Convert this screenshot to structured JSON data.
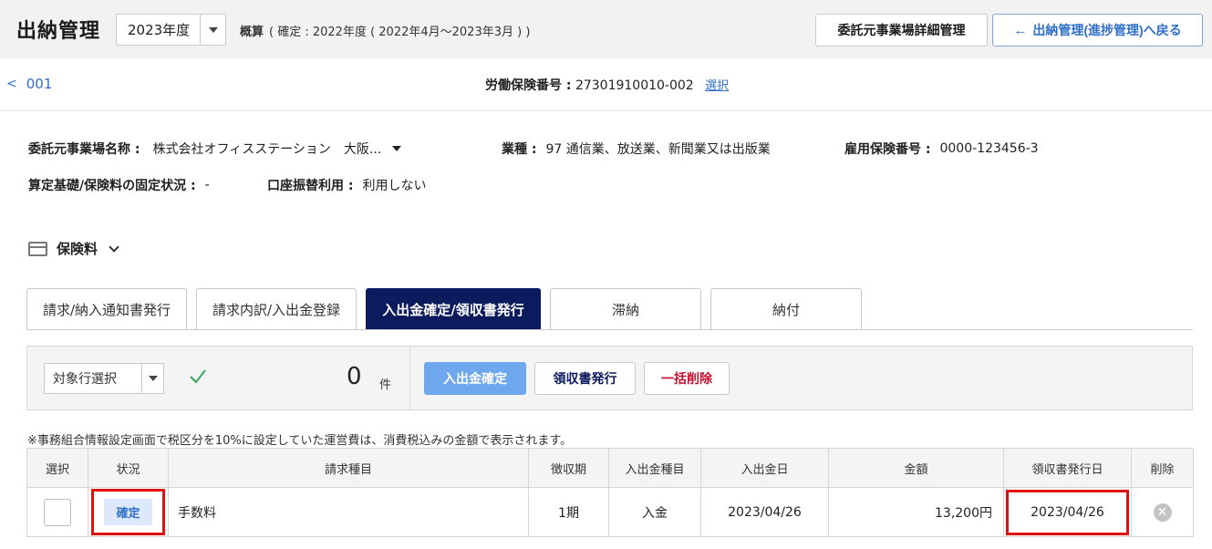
{
  "header": {
    "title": "出納管理",
    "year_select": "2023年度",
    "summary_label": "概算",
    "summary_text": "( 確定 : 2022年度 ( 2022年4月～2023年3月 ) )",
    "detail_button": "委託元事業場詳細管理",
    "back_button": "出納管理(進捗管理)へ戻る"
  },
  "subnav": {
    "back_link": "001",
    "insurance_label": "労働保険番号 :",
    "insurance_number": "27301910010-002",
    "select_link": "選択"
  },
  "info": {
    "office_label": "委託元事業場名称 :",
    "office_value": "株式会社オフィスステーション　大阪...",
    "industry_label": "業種 :",
    "industry_value": "97 通信業、放送業、新聞業又は出版業",
    "employment_label": "雇用保険番号 :",
    "employment_value": "0000-123456-3",
    "fixed_label": "算定基礎/保険料の固定状況 :",
    "fixed_value": "-",
    "account_label": "口座振替利用 :",
    "account_value": "利用しない"
  },
  "section": {
    "title": "保険料"
  },
  "tabs": [
    {
      "label": "請求/納入通知書発行"
    },
    {
      "label": "請求内訳/入出金登録"
    },
    {
      "label": "入出金確定/領収書発行"
    },
    {
      "label": "滞納"
    },
    {
      "label": "納付"
    }
  ],
  "toolbar": {
    "row_select": "対象行選択",
    "count": "0",
    "count_unit": "件",
    "confirm_button": "入出金確定",
    "receipt_button": "領収書発行",
    "delete_button": "一括削除"
  },
  "note": "※事務組合情報設定画面で税区分を10%に設定していた運営費は、消費税込みの金額で表示されます。",
  "table": {
    "headers": [
      "選択",
      "状況",
      "請求種目",
      "徴収期",
      "入出金種目",
      "入出金日",
      "金額",
      "領収書発行日",
      "削除"
    ],
    "rows": [
      {
        "status": "確定",
        "item": "手数料",
        "period": "1期",
        "type": "入金",
        "date": "2023/04/26",
        "amount": "13,200円",
        "receipt_date": "2023/04/26"
      }
    ]
  },
  "colors": {
    "accent": "#0c1a5e",
    "link": "#2f6fc9",
    "confirm": "#6fa7ee",
    "danger": "#c8102e",
    "highlight": "#e01010"
  }
}
